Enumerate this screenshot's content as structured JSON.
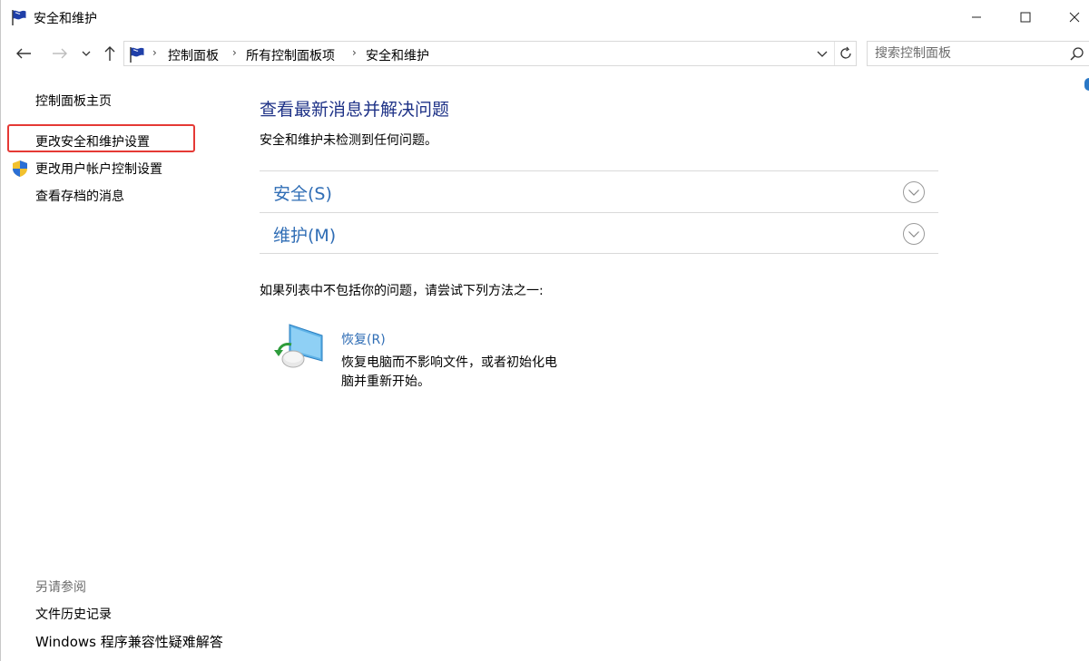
{
  "window": {
    "title": "安全和维护"
  },
  "address": {
    "breadcrumbs": [
      "控制面板",
      "所有控制面板项",
      "安全和维护"
    ],
    "search_placeholder": "搜索控制面板"
  },
  "sidebar": {
    "home": "控制面板主页",
    "change_settings": "更改安全和维护设置",
    "change_uac": "更改用户帐户控制设置",
    "archived": "查看存档的消息",
    "see_also_heading": "另请参阅",
    "file_history": "文件历史记录",
    "compat_troubleshooter": "Windows 程序兼容性疑难解答"
  },
  "main": {
    "title": "查看最新消息并解决问题",
    "subtitle": "安全和维护未检测到任何问题。",
    "sections": [
      {
        "label": "安全(S)"
      },
      {
        "label": "维护(M)"
      }
    ],
    "try_text": "如果列表中不包括你的问题，请尝试下列方法之一:",
    "recovery": {
      "link": "恢复(R)",
      "description": "恢复电脑而不影响文件，或者初始化电脑并重新开始。"
    }
  },
  "icons": {
    "title": "flag-icon",
    "address": "flag-icon",
    "uac": "shield-icon",
    "recovery": "recovery-icon"
  },
  "colors": {
    "heading": "#1e3287",
    "link": "#2f6db5",
    "highlight_box": "#e53935"
  }
}
